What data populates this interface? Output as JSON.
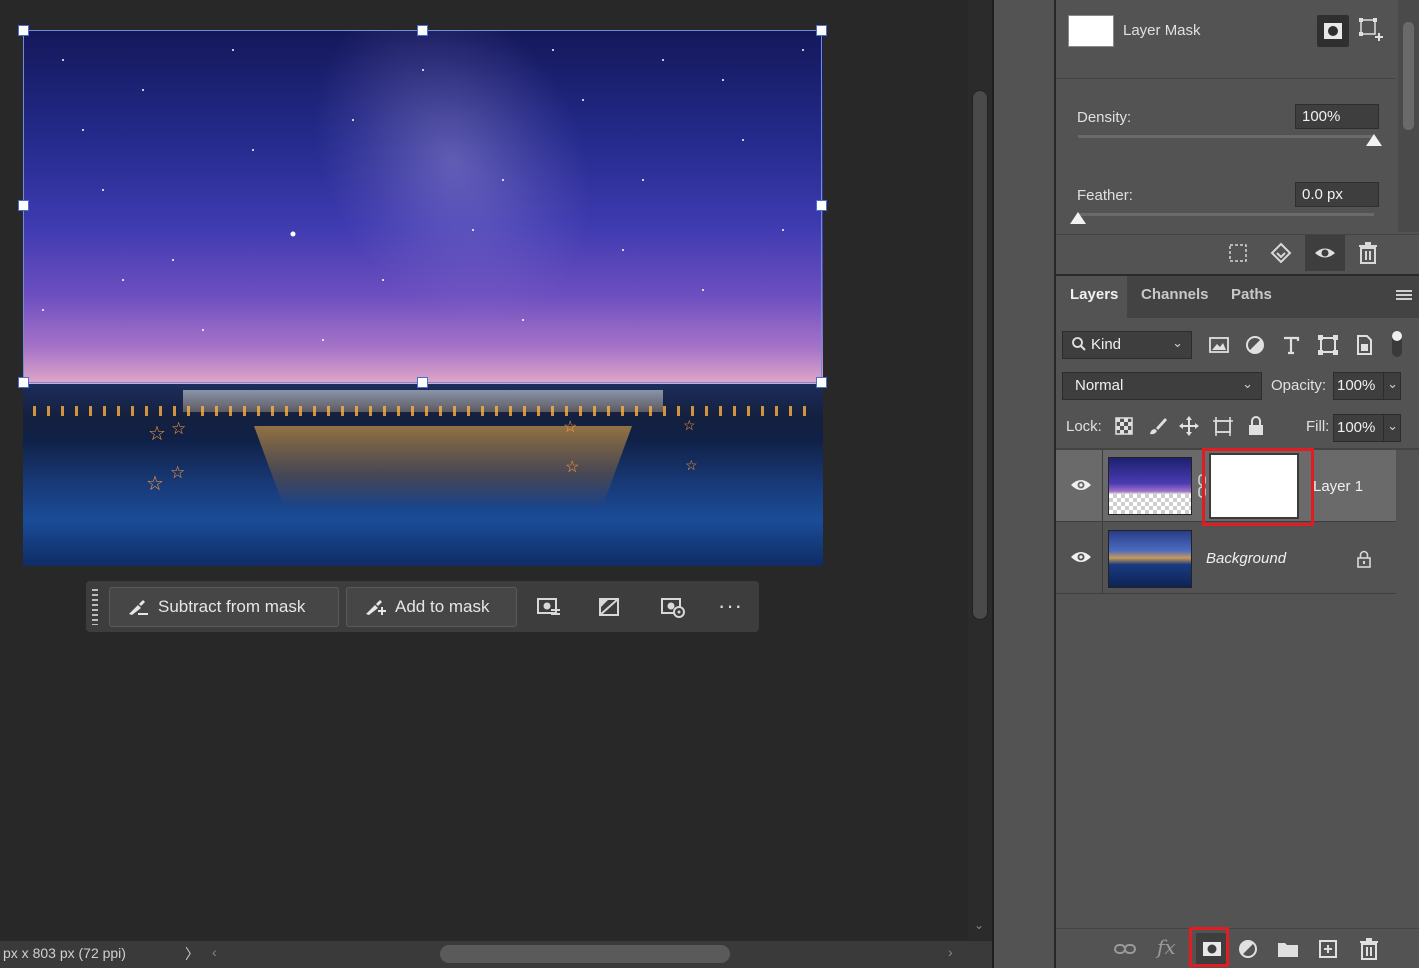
{
  "contextual_bar": {
    "subtract_label": "Subtract from mask",
    "add_label": "Add to mask",
    "more_label": "···"
  },
  "status_bar": {
    "doc_info": "px x 803 px (72 ppi)",
    "arrow": "〉",
    "scroll_left": "‹",
    "scroll_right": "›"
  },
  "properties": {
    "title": "Layer Mask",
    "density_label": "Density:",
    "density_value": "100%",
    "density_level": 1.0,
    "feather_label": "Feather:",
    "feather_value": "0.0 px",
    "feather_level": 0.0
  },
  "layers_panel": {
    "tabs": [
      "Layers",
      "Channels",
      "Paths"
    ],
    "active_tab": "Layers",
    "filter_kind": "Kind",
    "blend_mode": "Normal",
    "opacity_label": "Opacity:",
    "opacity_value": "100%",
    "lock_label": "Lock:",
    "fill_label": "Fill:",
    "fill_value": "100%",
    "layers": [
      {
        "name": "Layer 1",
        "visible": true,
        "selected": true,
        "has_mask": true,
        "locked": false
      },
      {
        "name": "Background",
        "visible": true,
        "selected": false,
        "has_mask": false,
        "locked": true
      }
    ]
  },
  "colors": {
    "highlight_box": "#e31b23",
    "selection_border": "#6f8dd8"
  },
  "icons": {
    "bottom_bar": [
      "link-layers-icon",
      "fx-icon",
      "add-mask-icon",
      "adjustment-icon",
      "group-folder-icon",
      "new-layer-icon",
      "delete-icon"
    ],
    "props_actions": [
      "load-selection-icon",
      "apply-mask-icon",
      "disable-mask-icon",
      "delete-mask-icon"
    ]
  },
  "bottom_bar": {
    "fx_label": "fx"
  }
}
